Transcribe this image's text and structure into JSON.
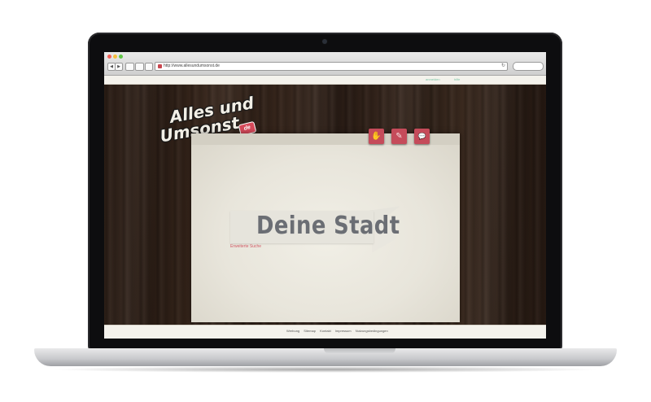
{
  "browser": {
    "url": "http://www.allesundumsonst.de",
    "reload_glyph": "↻",
    "back_glyph": "◀",
    "forward_glyph": "▶",
    "colors": {
      "close": "#f25f57",
      "minimize": "#f6bd3b",
      "zoom": "#5fc646"
    }
  },
  "site": {
    "top_links": [
      "anmelden",
      "hilfe"
    ],
    "logo": {
      "line1": "Alles und",
      "line2": "Umsonst",
      "badge": "de"
    },
    "actions": [
      {
        "name": "like-icon",
        "glyph": "✋"
      },
      {
        "name": "feather-icon",
        "glyph": "✎"
      },
      {
        "name": "chat-icon",
        "glyph": "💬"
      }
    ],
    "search_placeholder": "Deine Stadt",
    "advanced_search": "Erweiterte Suche",
    "footer_links": [
      "Werbung",
      "Sitemap",
      "Kontakt",
      "Impressum",
      "Nutzungsbedingungen"
    ],
    "colors": {
      "accent": "#c54b5a",
      "link_green": "#7fc7a8",
      "title_gray": "#6b6e74"
    }
  }
}
